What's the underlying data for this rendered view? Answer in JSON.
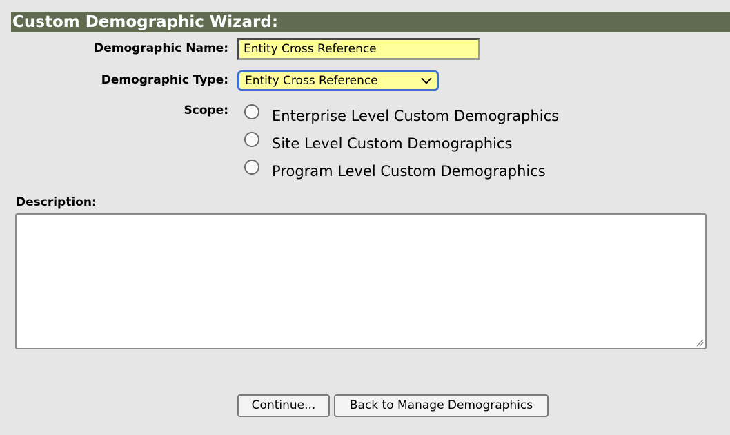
{
  "wizard": {
    "title": "Custom Demographic Wizard:"
  },
  "form": {
    "name_label": "Demographic Name:",
    "name_value": "Entity Cross Reference",
    "type_label": "Demographic Type:",
    "type_value": "Entity Cross Reference",
    "scope_label": "Scope:",
    "scope_options": [
      {
        "label": "Enterprise Level Custom Demographics",
        "checked": false
      },
      {
        "label": "Site Level Custom Demographics",
        "checked": false
      },
      {
        "label": "Program Level Custom Demographics",
        "checked": false
      }
    ],
    "description_label": "Description:",
    "description_value": ""
  },
  "actions": {
    "continue_label": "Continue...",
    "back_label": "Back to Manage Demographics"
  },
  "colors": {
    "title_bar": "#606b4f",
    "input_highlight": "#ffff99",
    "select_focus": "#3c6fd1"
  },
  "icons": {
    "select_arrow": "chevron-down-icon",
    "textarea_resize": "resize-grip-icon"
  }
}
